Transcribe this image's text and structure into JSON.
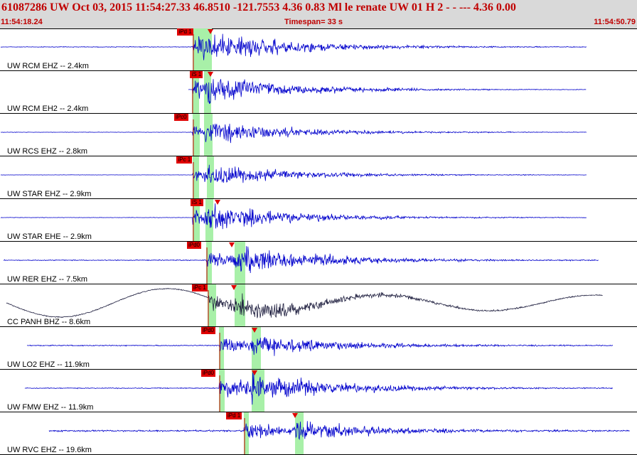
{
  "header": {
    "title": "61087286 UW Oct 03, 2015 11:54:27.33   46.8510 -121.7553  4.36 0.83 Ml le    renate   UW 01 H    2  -  - ---   4.36 0.00",
    "time_start": "11:54:18.24",
    "timespan": "Timespan=  33 s",
    "time_end": "11:54:50.79"
  },
  "colors": {
    "trace": "#0000cc",
    "trace_long_period": "#202040",
    "pick": "#e00000",
    "window": "#a8f0a8",
    "header_text": "#c00000"
  },
  "channels": [
    {
      "label": "UW RCM EHZ -- 2.4km",
      "pick": "iPd 1",
      "pick_x": 0.2784,
      "tri_x": 0.3304,
      "win": [
        [
          0.3024,
          0.3247
        ],
        [
          0.317,
          0.3326
        ]
      ],
      "start": 0.0011,
      "end": 0.9208,
      "type": "hf",
      "amp": 0.85,
      "noise": 0.03
    },
    {
      "label": "UW RCM EH2 -- 2.4km",
      "pick": "iS 1",
      "pick_x": 0.2985,
      "tri_x": 0.3304,
      "win": [
        [
          0.3013,
          0.3125
        ],
        [
          0.3203,
          0.3315
        ]
      ],
      "start": 0.2958,
      "end": 0.9208,
      "type": "hf",
      "amp": 0.75,
      "noise": 0.01
    },
    {
      "label": "UW RCS EHZ -- 2.8km",
      "pick": "iPc0",
      "pick_x": 0.2735,
      "tri_x": 0.0,
      "win": [
        [
          0.3024,
          0.3136
        ],
        [
          0.3203,
          0.3337
        ]
      ],
      "start": 0.0011,
      "end": 0.9208,
      "type": "hf",
      "amp": 0.6,
      "noise": 0.02
    },
    {
      "label": "UW STAR EHZ -- 2.9km",
      "pick": "iPc 1",
      "pick_x": 0.2773,
      "tri_x": 0.0,
      "win": [
        [
          0.3024,
          0.3125
        ],
        [
          0.3248,
          0.3359
        ]
      ],
      "start": 0.0011,
      "end": 0.9208,
      "type": "hf",
      "amp": 0.55,
      "noise": 0.015
    },
    {
      "label": "UW STAR EHE -- 2.9km",
      "pick": "iS 1",
      "pick_x": 0.2991,
      "tri_x": 0.3415,
      "win": [
        [
          0.3024,
          0.3136
        ],
        [
          0.3225,
          0.3348
        ]
      ],
      "start": 0.0011,
      "end": 0.9208,
      "type": "hf",
      "amp": 0.75,
      "noise": 0.02
    },
    {
      "label": "UW RER EHZ -- 7.5km",
      "pick": "iPd0",
      "pick_x": 0.2935,
      "tri_x": 0.3638,
      "win": [
        [
          0.3237,
          0.3326
        ],
        [
          0.3683,
          0.385
        ]
      ],
      "start": 0.0056,
      "end": 0.9397,
      "type": "hf",
      "amp": 0.85,
      "noise": 0.04
    },
    {
      "label": "CC PANH BHZ -- 8.6km",
      "pick": "iPc 1",
      "pick_x": 0.3013,
      "tri_x": 0.3672,
      "win": [
        [
          0.3259,
          0.3393
        ],
        [
          0.3683,
          0.385
        ]
      ],
      "start": 0.01,
      "end": 0.9464,
      "type": "lp",
      "amp": 0.7,
      "noise": 0.05
    },
    {
      "label": "UW LO2 EHZ -- 11.9km",
      "pick": "iPd0",
      "pick_x": 0.3158,
      "tri_x": 0.3995,
      "win": [
        [
          0.3438,
          0.3516
        ],
        [
          0.3951,
          0.4096
        ]
      ],
      "start": 0.0424,
      "end": 0.9621,
      "type": "hf",
      "amp": 0.65,
      "noise": 0.05
    },
    {
      "label": "UW FMW EHZ -- 11.9km",
      "pick": "iPd0",
      "pick_x": 0.3158,
      "tri_x": 0.3995,
      "win": [
        [
          0.3438,
          0.3527
        ],
        [
          0.3951,
          0.4152
        ]
      ],
      "start": 0.039,
      "end": 0.9621,
      "type": "hf",
      "amp": 0.9,
      "noise": 0.04
    },
    {
      "label": "UW RVC EHZ -- 19.6km",
      "pick": "iPd 1",
      "pick_x": 0.3549,
      "tri_x": 0.4632,
      "win": [
        [
          0.3828,
          0.3906
        ],
        [
          0.4632,
          0.4766
        ]
      ],
      "start": 0.077,
      "end": 0.9888,
      "type": "hf",
      "amp": 0.65,
      "noise": 0.08
    }
  ]
}
